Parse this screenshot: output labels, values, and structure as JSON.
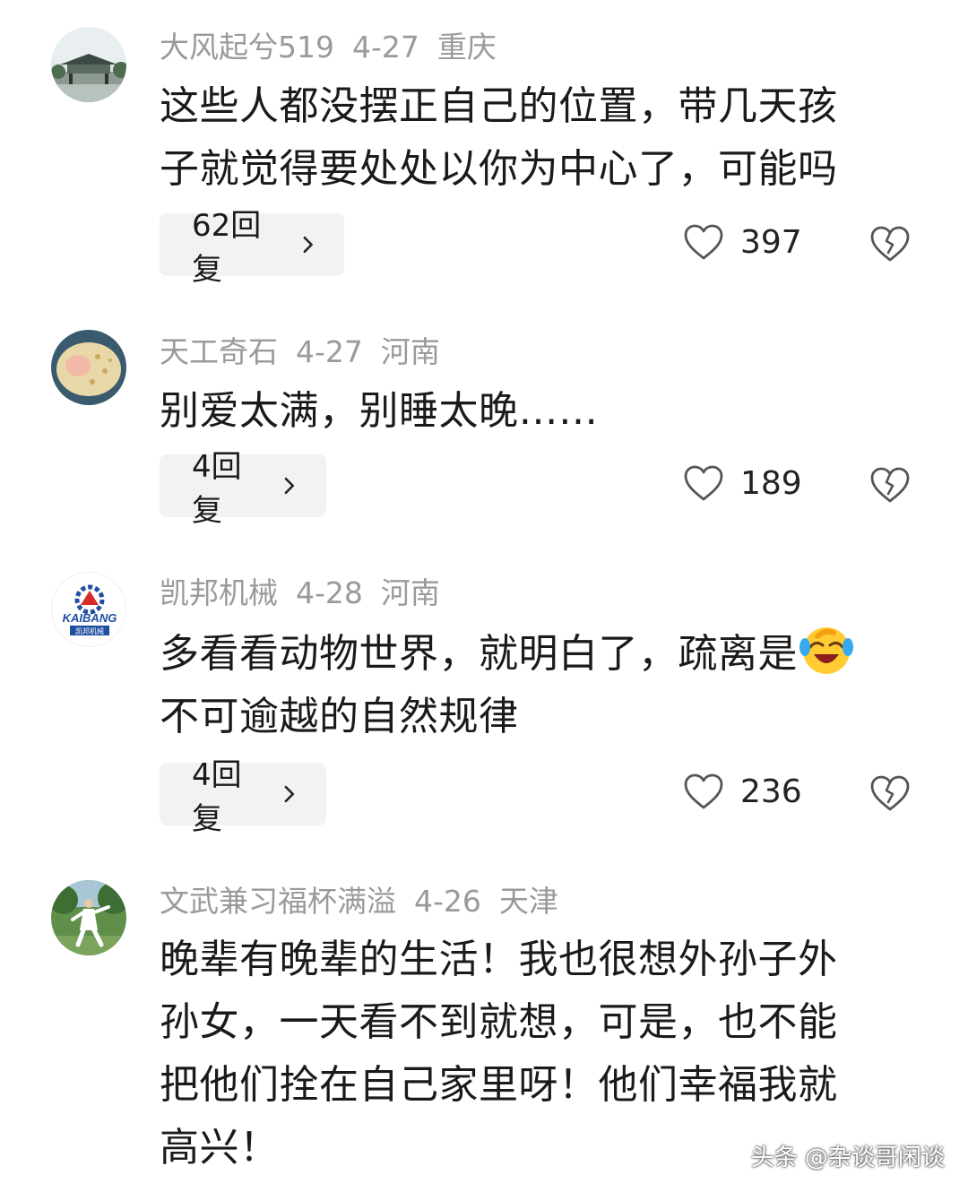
{
  "comments": [
    {
      "username": "大风起兮519",
      "date": "4-27",
      "location": "重庆",
      "lines": [
        "这些人都没摆正自己的位置，带几天孩",
        "子就觉得要处处以你为中心了，可能吗"
      ],
      "replies": "62回复",
      "likes": "397",
      "avatar_icon": "pavilion-avatar"
    },
    {
      "username": "天工奇石",
      "date": "4-27",
      "location": "河南",
      "lines": [
        "别爱太满，别睡太晚……"
      ],
      "replies": "4回复",
      "likes": "189",
      "avatar_icon": "stone-avatar"
    },
    {
      "username": "凯邦机械",
      "date": "4-28",
      "location": "河南",
      "lines": [
        "多看看动物世界，就明白了，疏离是",
        "不可逾越的自然规律"
      ],
      "replies": "4回复",
      "likes": "236",
      "avatar_icon": "kaibang-logo-avatar",
      "avatar_logo_text": "KAIBANG",
      "avatar_logo_sub": "凯邦机械",
      "emoji": "laughing-crying-emoji"
    },
    {
      "username": "文武兼习福杯满溢",
      "date": "4-26",
      "location": "天津",
      "lines": [
        "晚辈有晚辈的生活！我也很想外孙子外",
        "孙女，一天看不到就想，可是，也不能",
        "把他们拴在自己家里呀！他们幸福我就",
        "高兴！"
      ],
      "avatar_icon": "taichi-avatar"
    }
  ],
  "watermark": "头条 @杂谈哥闲谈",
  "colors": {
    "meta_text": "#9a9a9a",
    "reply_bg": "#f2f2f2",
    "text": "#1a1a1a",
    "icon_stroke": "#555555"
  }
}
